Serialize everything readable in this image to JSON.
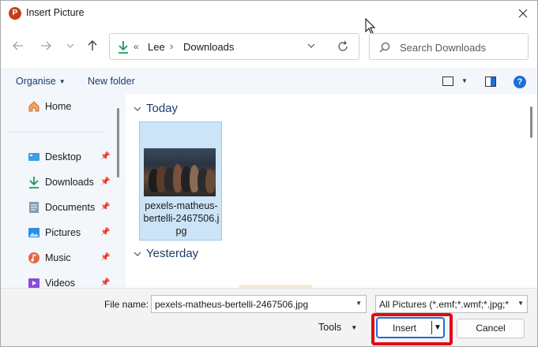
{
  "window": {
    "title": "Insert Picture",
    "app_icon": "P"
  },
  "nav": {
    "breadcrumb": [
      "Lee",
      "Downloads"
    ],
    "overflow_glyph": "«",
    "separator_glyph": "›",
    "search_placeholder": "Search Downloads"
  },
  "commands": {
    "organise": "Organise",
    "new_folder": "New folder",
    "help": "?"
  },
  "sidebar": {
    "items": [
      {
        "label": "Home",
        "icon": "home-icon",
        "pinned": false
      },
      {
        "label": "Desktop",
        "icon": "desktop-icon",
        "pinned": true
      },
      {
        "label": "Downloads",
        "icon": "download-icon",
        "pinned": true
      },
      {
        "label": "Documents",
        "icon": "documents-icon",
        "pinned": true
      },
      {
        "label": "Pictures",
        "icon": "pictures-icon",
        "pinned": true
      },
      {
        "label": "Music",
        "icon": "music-icon",
        "pinned": true
      },
      {
        "label": "Videos",
        "icon": "videos-icon",
        "pinned": true
      }
    ]
  },
  "content": {
    "groups": [
      {
        "label": "Today"
      },
      {
        "label": "Yesterday"
      }
    ],
    "files": [
      {
        "name": "pexels-matheus-bertelli-2467506.jpg",
        "name_display": "pexels-matheus-bertelli-2467506.jpg",
        "selected": true
      }
    ]
  },
  "footer": {
    "file_name_label": "File name:",
    "file_name_value": "pexels-matheus-bertelli-2467506.jpg",
    "file_type": "All Pictures (*.emf;*.wmf;*.jpg;*",
    "tools": "Tools",
    "insert": "Insert",
    "cancel": "Cancel"
  },
  "colors": {
    "accent": "#1e6fd9",
    "highlight": "#e10c14",
    "selection": "#cce4f7",
    "app_brand": "#c43e1c"
  }
}
